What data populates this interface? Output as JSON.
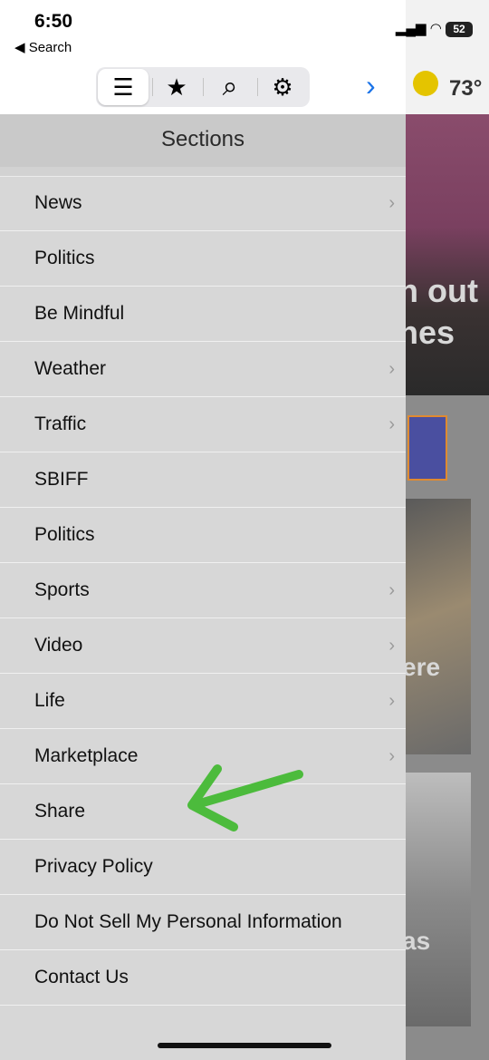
{
  "status_bar": {
    "time": "6:50",
    "back_label": "◀ Search",
    "battery": "52"
  },
  "toolbar": {
    "tabs": [
      {
        "icon": "list-icon",
        "glyph": "☰"
      },
      {
        "icon": "star-icon",
        "glyph": "★"
      },
      {
        "icon": "search-icon",
        "glyph": "⌕"
      },
      {
        "icon": "gear-icon",
        "glyph": "⚙"
      }
    ],
    "forward_glyph": "›"
  },
  "background": {
    "temperature": "73°",
    "headline_fragment_1": "n out",
    "headline_fragment_2": "hes",
    "headline_fragment_3": "ere",
    "headline_fragment_4": "as"
  },
  "sections": {
    "title": "Sections",
    "items": [
      {
        "label": "News",
        "chevron": true
      },
      {
        "label": "Politics",
        "chevron": false
      },
      {
        "label": "Be Mindful",
        "chevron": false
      },
      {
        "label": "Weather",
        "chevron": true
      },
      {
        "label": "Traffic",
        "chevron": true
      },
      {
        "label": "SBIFF",
        "chevron": false
      },
      {
        "label": "Politics",
        "chevron": false
      },
      {
        "label": "Sports",
        "chevron": true
      },
      {
        "label": "Video",
        "chevron": true
      },
      {
        "label": "Life",
        "chevron": true
      },
      {
        "label": "Marketplace",
        "chevron": true
      },
      {
        "label": "Share",
        "chevron": false
      },
      {
        "label": "Privacy Policy",
        "chevron": false
      },
      {
        "label": "Do Not Sell My Personal Information",
        "chevron": false
      },
      {
        "label": "Contact Us",
        "chevron": false
      }
    ]
  },
  "colors": {
    "accent": "#1a73e8",
    "annotation_arrow": "#4cbb3c"
  }
}
